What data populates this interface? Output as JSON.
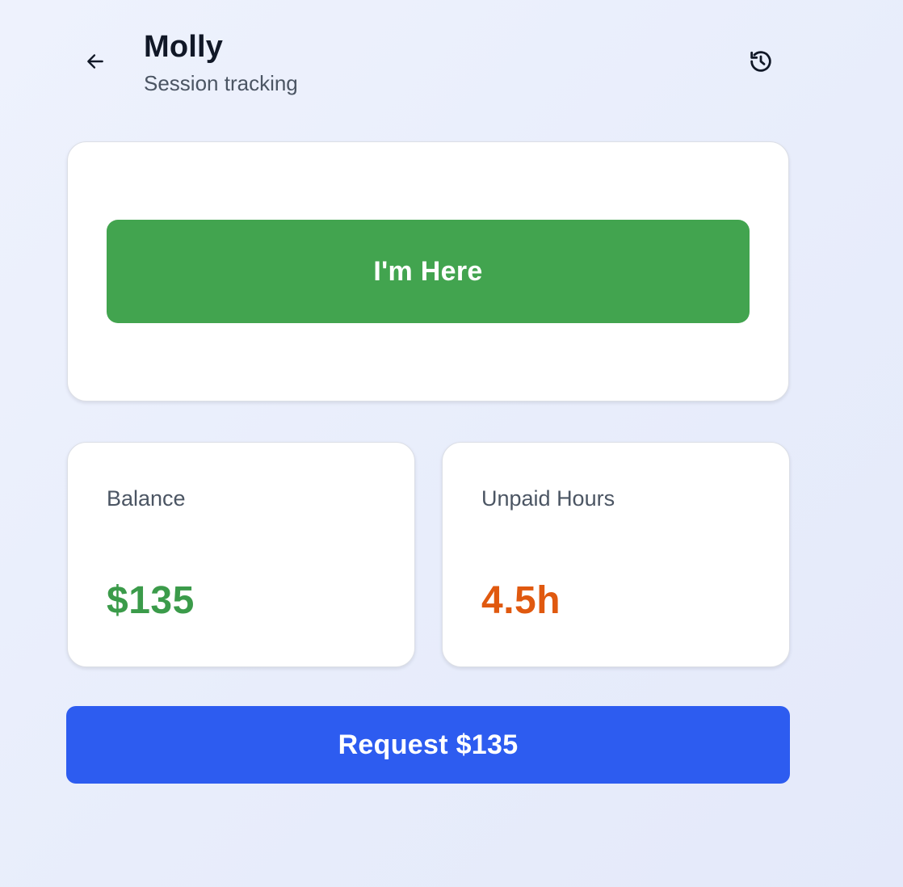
{
  "header": {
    "title": "Molly",
    "subtitle": "Session tracking",
    "back_icon": "arrow-left-icon",
    "history_icon": "history-icon"
  },
  "checkin": {
    "button_label": "I'm Here",
    "button_color": "#42a44f"
  },
  "stats": {
    "balance": {
      "label": "Balance",
      "value": "$135",
      "color": "#3b9b4a"
    },
    "unpaid_hours": {
      "label": "Unpaid Hours",
      "value": "4.5h",
      "color": "#e0590f"
    }
  },
  "request": {
    "button_label": "Request $135",
    "button_color": "#2d5cf0"
  }
}
